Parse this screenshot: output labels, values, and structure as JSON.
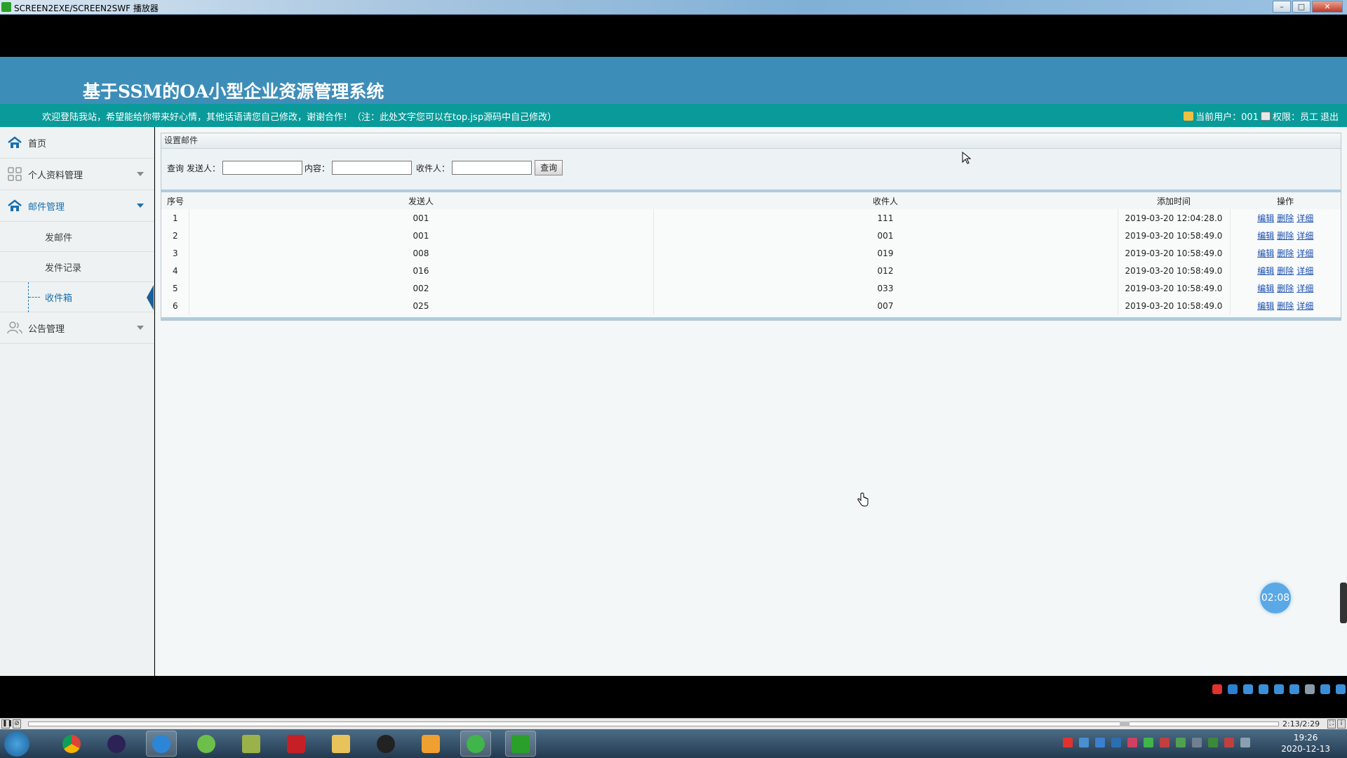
{
  "window": {
    "title": "SCREEN2EXE/SCREEN2SWF 播放器",
    "min": "–",
    "max": "□",
    "close": "✕"
  },
  "header": {
    "system_title": "基于SSM的OA小型企业资源管理系统",
    "welcome": "欢迎登陆我站，希望能给你带来好心情，其他话语请您自己修改，谢谢合作！（注：此处文字您可以在top.jsp源码中自己修改）",
    "current_user_label": "当前用户：001",
    "role_label": "权限：员工",
    "logout": "退出"
  },
  "sidebar": {
    "items": [
      {
        "label": "首页"
      },
      {
        "label": "个人资料管理"
      },
      {
        "label": "邮件管理"
      },
      {
        "label": "公告管理"
      }
    ],
    "mail_sub": [
      {
        "label": "发邮件"
      },
      {
        "label": "发件记录"
      },
      {
        "label": "收件箱"
      }
    ]
  },
  "panel": {
    "title": "设置邮件",
    "search": {
      "query_label": "查询",
      "sender_label": "发送人：",
      "content_label": "内容：",
      "receiver_label": "收件人：",
      "sender_value": "",
      "content_value": "",
      "receiver_value": "",
      "button": "查询"
    }
  },
  "table": {
    "headers": [
      "序号",
      "发送人",
      "收件人",
      "添加时间",
      "操作"
    ],
    "rows": [
      {
        "idx": "1",
        "sender": "001",
        "receiver": "111",
        "time": "2019-03-20 12:04:28.0"
      },
      {
        "idx": "2",
        "sender": "001",
        "receiver": "001",
        "time": "2019-03-20 10:58:49.0"
      },
      {
        "idx": "3",
        "sender": "008",
        "receiver": "019",
        "time": "2019-03-20 10:58:49.0"
      },
      {
        "idx": "4",
        "sender": "016",
        "receiver": "012",
        "time": "2019-03-20 10:58:49.0"
      },
      {
        "idx": "5",
        "sender": "002",
        "receiver": "033",
        "time": "2019-03-20 10:58:49.0"
      },
      {
        "idx": "6",
        "sender": "025",
        "receiver": "007",
        "time": "2019-03-20 10:58:49.0"
      }
    ],
    "actions": {
      "edit": "编辑",
      "delete": "删除",
      "detail": "详细"
    }
  },
  "timer_badge": "02:08",
  "player": {
    "time": "2:13/2:29",
    "progress": 0.88
  },
  "taskbar": {
    "time": "19:26",
    "date": "2020-12-13"
  },
  "colors": {
    "header": "#3d8db9",
    "infobar": "#0a9a9a",
    "accent": "#1a6fb0"
  }
}
